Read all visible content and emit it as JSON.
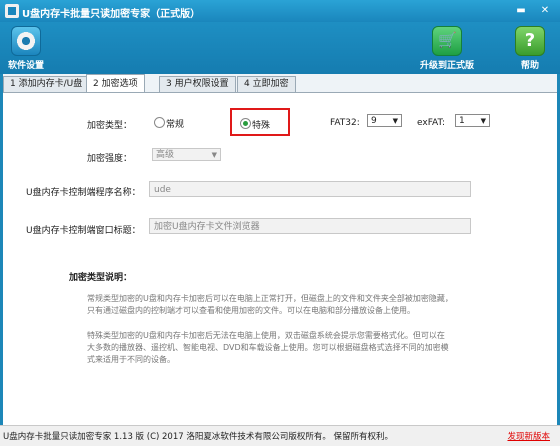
{
  "window": {
    "title": "U盘内存卡批量只读加密专家（正式版）",
    "minimize": "▬",
    "close": "✕"
  },
  "toolbar": {
    "settings_label": "软件设置",
    "upgrade_label": "升级到正式版",
    "help_label": "帮助",
    "help_glyph": "?"
  },
  "tabs": [
    {
      "label": "1 添加内存卡/U盘"
    },
    {
      "label": "2 加密选项"
    },
    {
      "label": "3 用户权限设置"
    },
    {
      "label": "4 立即加密"
    }
  ],
  "encryption": {
    "type_label": "加密类型：",
    "option_normal": "常规",
    "option_special": "特殊",
    "selected": "特殊",
    "fat32_label": "FAT32:",
    "fat32_value": "9",
    "exfat_label": "exFAT:",
    "exfat_value": "1",
    "strength_label": "加密强度：",
    "strength_value": "高级",
    "program_name_label": "U盘内存卡控制端程序名称：",
    "program_name_value": "ude",
    "window_title_label": "U盘内存卡控制端窗口标题：",
    "window_title_value": "加密U盘内存卡文件浏览器"
  },
  "description": {
    "heading": "加密类型说明：",
    "normal_line1": "常规类型加密的U盘和内存卡加密后可以在电脑上正常打开，但磁盘上的文件和文件夹全部被加密隐藏，",
    "normal_line2": "只有通过磁盘内的控制端才可以查看和使用加密的文件。可以在电脑和部分播放设备上使用。",
    "special_line1": "特殊类型加密的U盘和内存卡加密后无法在电脑上使用，双击磁盘系统会提示您需要格式化。但可以在",
    "special_line2": "大多数的播放器、遥控机、智能电视、DVD和车载设备上使用。您可以根据磁盘格式选择不同的加密模",
    "special_line3": "式来适用于不同的设备。"
  },
  "status": {
    "text": "U盘内存卡批量只读加密专家 1.13 版  (C)  2017 洛阳夏冰软件技术有限公司版权所有。  保留所有权利。",
    "new_version": "发现新版本"
  },
  "colors": {
    "titlebar": "#1a86bc",
    "highlight": "#e01919",
    "link": "#e00000"
  }
}
